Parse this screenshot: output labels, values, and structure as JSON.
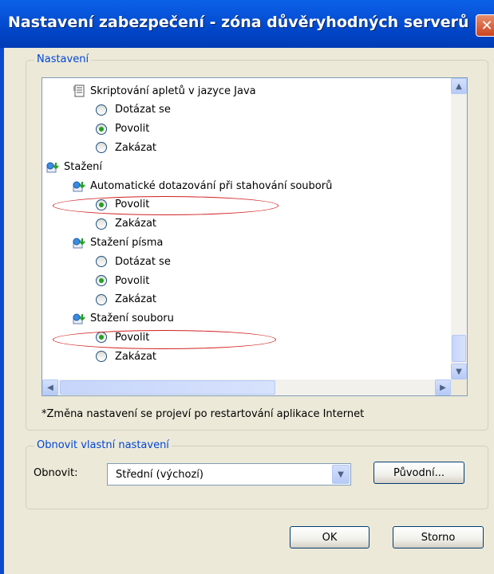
{
  "window": {
    "title": "Nastavení zabezpečení - zóna důvěryhodných serverů",
    "close_glyph": "✕"
  },
  "settings_group": {
    "label": "Nastavení",
    "items": [
      {
        "type": "category",
        "label": "Skriptování apletů v jazyce Java",
        "icon": "script-icon",
        "checked": false
      },
      {
        "type": "option",
        "label": "Dotázat se",
        "checked": false
      },
      {
        "type": "option",
        "label": "Povolit",
        "checked": true
      },
      {
        "type": "option",
        "label": "Zakázat",
        "checked": false
      },
      {
        "type": "category",
        "label": "Stažení",
        "icon": "download-icon",
        "checked": false
      },
      {
        "type": "category",
        "label": "Automatické dotazování při stahování souborů",
        "icon": "download-icon",
        "checked": false
      },
      {
        "type": "option",
        "label": "Povolit",
        "checked": true
      },
      {
        "type": "option",
        "label": "Zakázat",
        "checked": false
      },
      {
        "type": "category",
        "label": "Stažení písma",
        "icon": "download-icon",
        "checked": false
      },
      {
        "type": "option",
        "label": "Dotázat se",
        "checked": false
      },
      {
        "type": "option",
        "label": "Povolit",
        "checked": true
      },
      {
        "type": "option",
        "label": "Zakázat",
        "checked": false
      },
      {
        "type": "category",
        "label": "Stažení souboru",
        "icon": "download-icon",
        "checked": false
      },
      {
        "type": "option",
        "label": "Povolit",
        "checked": true
      },
      {
        "type": "option",
        "label": "Zakázat",
        "checked": false
      }
    ],
    "note": "*Změna nastavení se projeví po restartování aplikace Internet"
  },
  "reset_group": {
    "label": "Obnovit vlastní nastavení",
    "reset_label": "Obnovit:",
    "reset_value": "Střední (výchozí)",
    "reset_button": "Původní..."
  },
  "buttons": {
    "ok": "OK",
    "cancel": "Storno"
  },
  "colors": {
    "titlebar": "#0147C9",
    "accent": "#0046D5",
    "highlight_oval": "#D32020",
    "radio_dot": "#21A121"
  }
}
